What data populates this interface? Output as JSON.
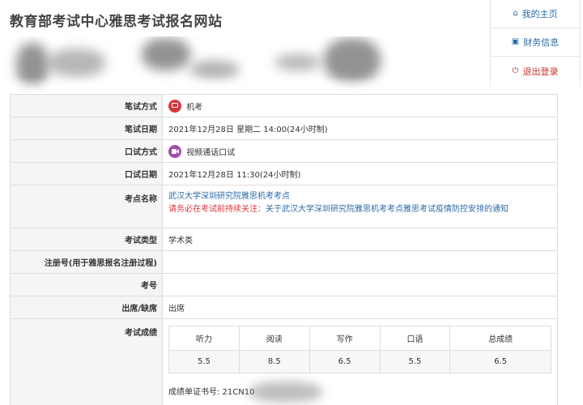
{
  "header": {
    "site_title": "教育部考试中心雅思考试报名网站"
  },
  "nav": {
    "home_label": "我的主页",
    "finance_label": "财务信息",
    "logout_label": "退出登录"
  },
  "exam": {
    "written_mode_label": "笔试方式",
    "written_mode_value": "机考",
    "written_date_label": "笔试日期",
    "written_date_value": "2021年12月28日 星期二 14:00(24小时制)",
    "speaking_mode_label": "口试方式",
    "speaking_mode_value": "视频通话口试",
    "speaking_date_label": "口试日期",
    "speaking_date_value": "2021年12月28日 11:30(24小时制)",
    "center_label": "考点名称",
    "center_name": "武汉大学深圳研究院雅思机考考点",
    "center_notice_prefix": "请务必在考试前持续关注：",
    "center_notice_link": "关于武汉大学深圳研究院雅思机考考点雅思考试疫情防控安排的通知",
    "exam_type_label": "考试类型",
    "exam_type_value": "学术类",
    "registration_label": "注册号(用于雅思报名注册过程)",
    "candidate_no_label": "考号",
    "attendance_label": "出席/缺席",
    "attendance_value": "出席",
    "scores_label": "考试成绩"
  },
  "scores": {
    "headers": [
      "听力",
      "阅读",
      "写作",
      "口语",
      "总成绩"
    ],
    "values": [
      "5.5",
      "8.5",
      "6.5",
      "5.5",
      "6.5"
    ]
  },
  "certificate": {
    "label_prefix": "成绩单证书号: 21CN10"
  },
  "colors": {
    "link": "#2a6aa8",
    "danger": "#d9363e",
    "video_icon": "#a24cae",
    "label_bg": "#f5f5f5"
  },
  "icons": {
    "home": "home-icon",
    "finance": "briefcase-icon",
    "logout": "power-icon",
    "computer_test": "monitor-icon",
    "video_call": "video-camera-icon"
  }
}
